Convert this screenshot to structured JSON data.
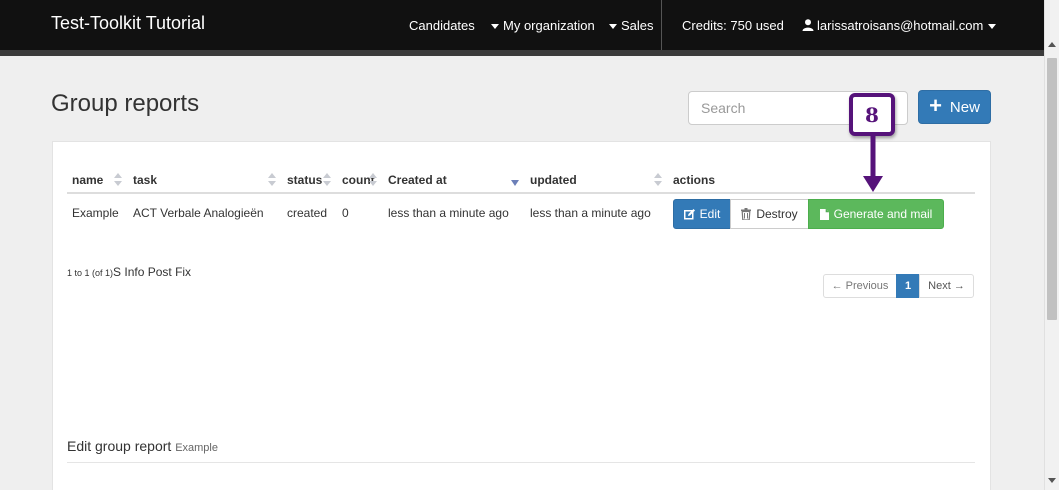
{
  "navbar": {
    "brand": "Test-Toolkit Tutorial",
    "candidates": "Candidates",
    "my_organization": "My organization",
    "sales": "Sales",
    "credits": "Credits: 750 used",
    "user_email": "larissatroisans@hotmail.com"
  },
  "page": {
    "title": "Group reports",
    "search_placeholder": "Search",
    "new_label": "New"
  },
  "table": {
    "columns": [
      "name",
      "task",
      "status",
      "count",
      "Created at",
      "updated",
      "actions"
    ],
    "rows": [
      {
        "name": "Example",
        "task": "ACT Verbale Analogieën",
        "status": "created",
        "count": "0",
        "created_at": "less than a minute ago",
        "updated": "less than a minute ago"
      }
    ],
    "actions": {
      "edit": "Edit",
      "destroy": "Destroy",
      "generate": "Generate and mail"
    }
  },
  "info": {
    "range": "1 to 1 (of 1)",
    "suffix": "S Info Post Fix"
  },
  "pagination": {
    "previous": "← Previous",
    "current": "1",
    "next": "Next →"
  },
  "edit_section": {
    "heading": "Edit group report",
    "subject": "Example"
  },
  "annotation": {
    "step": "8",
    "color": "#56137a"
  },
  "colors": {
    "primary": "#337ab7",
    "success": "#5cb85c",
    "navbar": "#111111"
  }
}
